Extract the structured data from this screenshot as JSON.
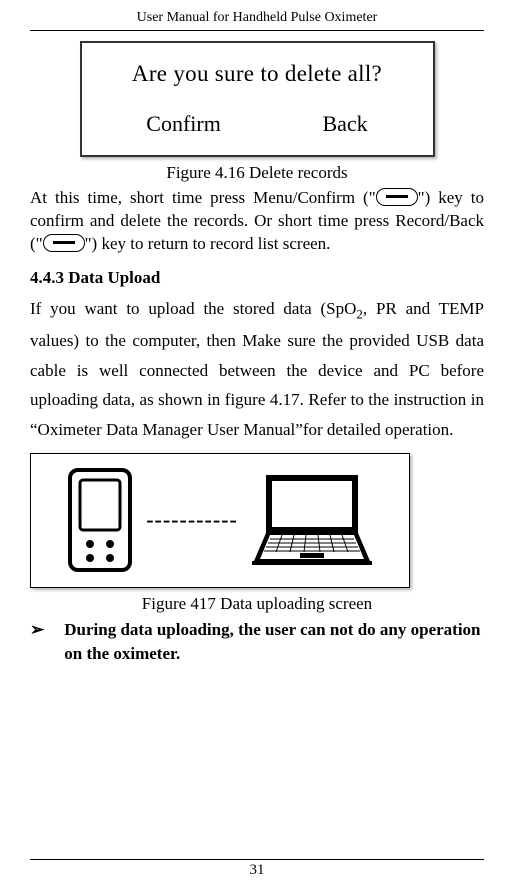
{
  "header": {
    "title": "User Manual for Handheld Pulse Oximeter"
  },
  "dialog": {
    "title": "Are you sure to delete all?",
    "confirm": "Confirm",
    "back": "Back"
  },
  "figure1": {
    "caption": "Figure 4.16 Delete records"
  },
  "paragraph1": {
    "part1": "At this time, short time press Menu/Confirm (\"",
    "part2": "\") key to confirm and delete the records. Or short time press Record/Back (\"",
    "part3": "\") key to return to record list screen."
  },
  "section": {
    "heading": "4.4.3 Data Upload"
  },
  "paragraph2": {
    "part1": "If you want to upload the stored data (SpO",
    "sub": "2",
    "part2": ", PR and TEMP values) to the computer, then Make sure the provided USB data cable is well connected between the device and PC before uploading data, as shown in figure 4.17. Refer to the instruction in “Oximeter Data Manager User Manual”for detailed operation."
  },
  "figure2": {
    "caption": "Figure 417 Data uploading screen",
    "dashes": "-----------"
  },
  "bullet": {
    "marker": "➢",
    "text": "During data uploading, the user can not do any operation on the oximeter."
  },
  "footer": {
    "page": "31"
  }
}
